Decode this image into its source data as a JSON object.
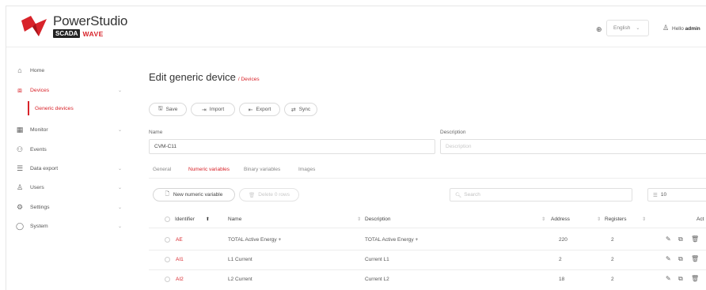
{
  "app": {
    "brand": "PowerStudio",
    "badge_scada": "SCADA",
    "badge_wave": "WAVE",
    "accent_color": "#d8232a"
  },
  "header": {
    "language": "English",
    "greeting": "Hello",
    "username": "admin"
  },
  "sidebar": {
    "items": [
      {
        "label": "Home",
        "icon": "home-icon",
        "expandable": false
      },
      {
        "label": "Devices",
        "icon": "devices-icon",
        "expandable": true
      },
      {
        "label": "Monitor",
        "icon": "monitor-icon",
        "expandable": true
      },
      {
        "label": "Events",
        "icon": "events-icon",
        "expandable": false
      },
      {
        "label": "Data export",
        "icon": "database-icon",
        "expandable": true
      },
      {
        "label": "Users",
        "icon": "user-icon",
        "expandable": true
      },
      {
        "label": "Settings",
        "icon": "gear-icon",
        "expandable": true
      },
      {
        "label": "System",
        "icon": "system-icon",
        "expandable": true
      }
    ],
    "subitem": "Generic devices"
  },
  "page": {
    "title": "Edit generic device",
    "breadcrumb": "/ Devices"
  },
  "toolbar": {
    "save": "Save",
    "import": "Import",
    "export": "Export",
    "sync": "Sync"
  },
  "form": {
    "name_label": "Name",
    "name_value": "CVM-C11",
    "description_label": "Description",
    "description_placeholder": "Description"
  },
  "tabs": [
    {
      "label": "General"
    },
    {
      "label": "Numeric variables"
    },
    {
      "label": "Binary variables"
    },
    {
      "label": "Images"
    }
  ],
  "table_controls": {
    "new_button": "New numeric variable",
    "delete_button": "Delete 0 rows",
    "search_placeholder": "Search",
    "page_size": "10"
  },
  "table": {
    "columns": [
      "Identifier",
      "Name",
      "Description",
      "Address",
      "Registers",
      "Act"
    ],
    "rows": [
      {
        "id": "AE",
        "name": "TOTAL Active Energy +",
        "description": "TOTAL Active Energy +",
        "address": "220",
        "registers": "2"
      },
      {
        "id": "AI1",
        "name": "L1 Current",
        "description": "Current L1",
        "address": "2",
        "registers": "2"
      },
      {
        "id": "AI2",
        "name": "L2 Current",
        "description": "Current L2",
        "address": "18",
        "registers": "2"
      }
    ]
  }
}
